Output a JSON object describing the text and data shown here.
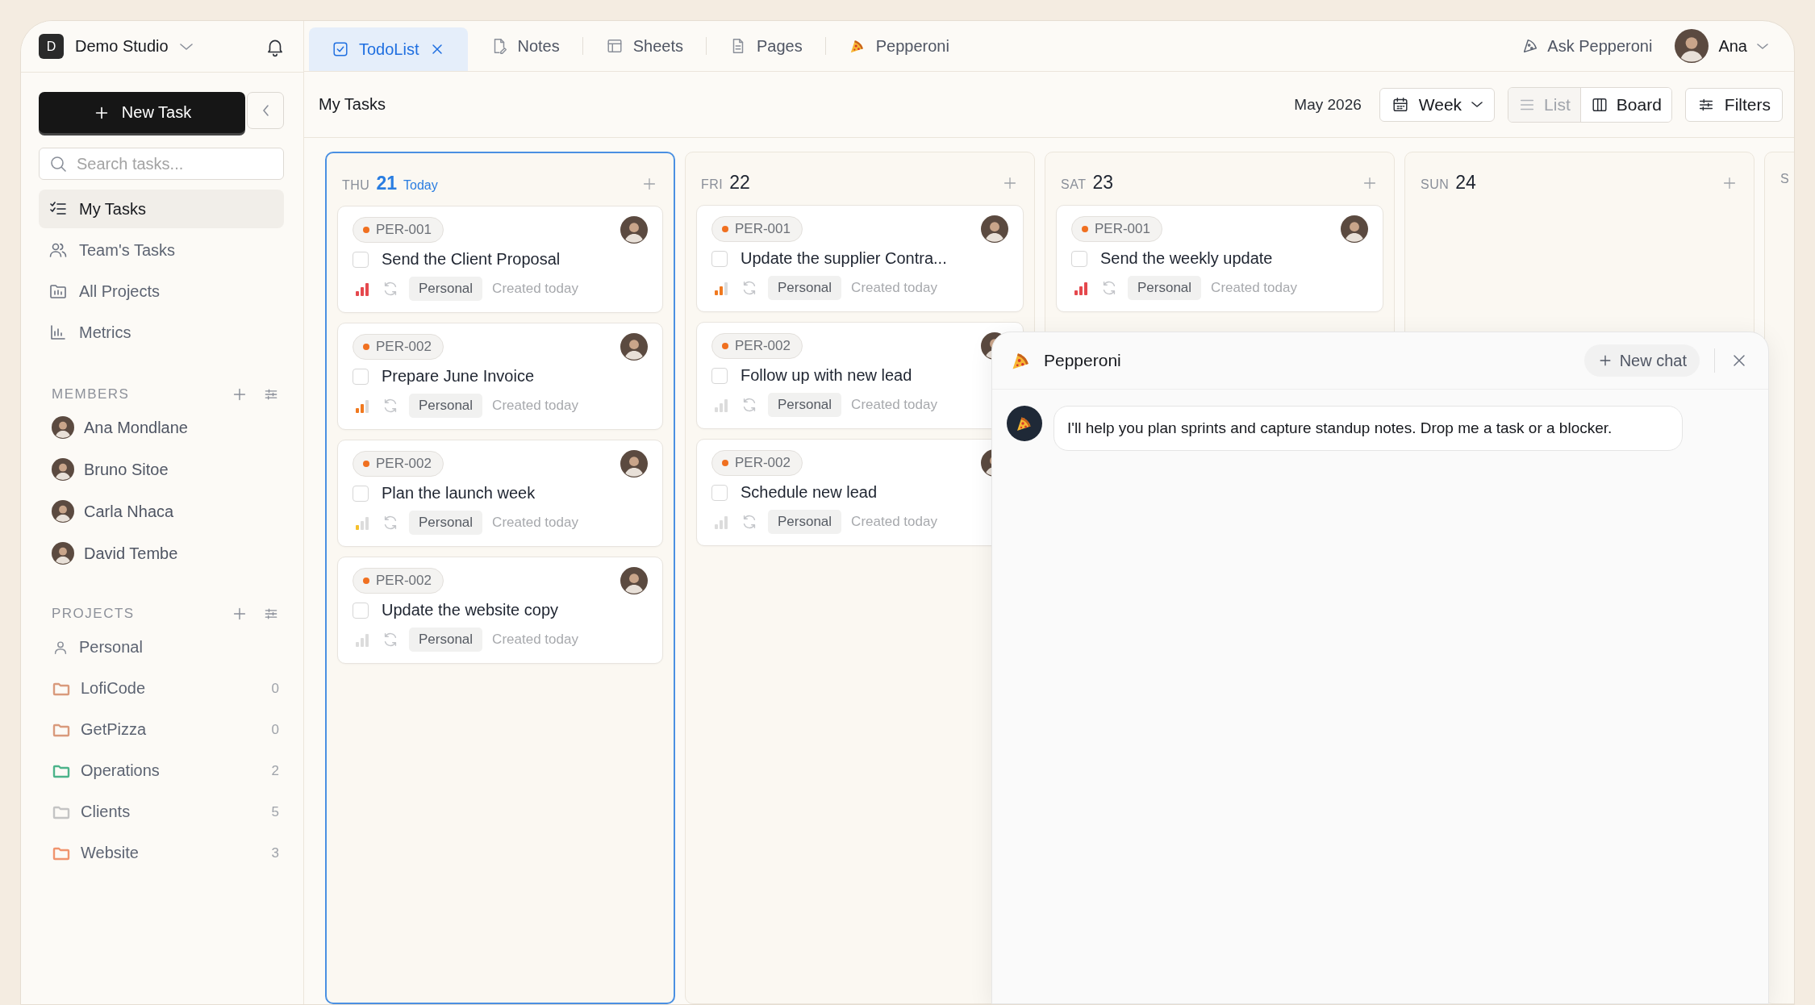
{
  "workspace": {
    "initial": "D",
    "name": "Demo Studio"
  },
  "sidebar": {
    "new_task": "New Task",
    "search": {
      "placeholder": "Search tasks..."
    },
    "nav": [
      {
        "label": "My Tasks",
        "selected": true
      },
      {
        "label": "Team's Tasks",
        "selected": false
      },
      {
        "label": "All Projects",
        "selected": false
      },
      {
        "label": "Metrics",
        "selected": false
      }
    ],
    "members": {
      "title": "MEMBERS",
      "items": [
        {
          "name": "Ana Mondlane"
        },
        {
          "name": "Bruno Sitoe"
        },
        {
          "name": "Carla Nhaca"
        },
        {
          "name": "David Tembe"
        }
      ]
    },
    "projects": {
      "title": "PROJECTS",
      "items": [
        {
          "kind": "person",
          "name": "Personal"
        },
        {
          "kind": "folder",
          "name": "LofiCode",
          "color": "#d99a7c",
          "count": "0"
        },
        {
          "kind": "folder",
          "name": "GetPizza",
          "color": "#d99a7c",
          "count": "0"
        },
        {
          "kind": "folder",
          "name": "Operations",
          "color": "#4cb38a",
          "count": "2"
        },
        {
          "kind": "folder",
          "name": "Clients",
          "color": "#c4c4c4",
          "count": "5"
        },
        {
          "kind": "folder",
          "name": "Website",
          "color": "#f0946e",
          "count": "3"
        }
      ]
    }
  },
  "tabs": [
    {
      "label": "TodoList",
      "selected": true
    },
    {
      "label": "Notes",
      "selected": false
    },
    {
      "label": "Sheets",
      "selected": false
    },
    {
      "label": "Pages",
      "selected": false
    },
    {
      "label": "Pepperoni",
      "selected": false
    }
  ],
  "header": {
    "ask": "Ask Pepperoni",
    "user": "Ana"
  },
  "toolbar": {
    "title": "My Tasks",
    "month": "May 2026",
    "range": "Week",
    "views": [
      {
        "label": "List",
        "selected": false
      },
      {
        "label": "Board",
        "selected": true
      }
    ],
    "filters": "Filters"
  },
  "columns": [
    {
      "weekday": "THU",
      "day": "21",
      "today": true,
      "today_label": "Today",
      "cards": [
        {
          "id": "PER-001",
          "title": "Send the Client Proposal",
          "checked": false,
          "level": 1,
          "tag": "Personal",
          "created": "Created today"
        },
        {
          "id": "PER-002",
          "title": "Prepare June Invoice",
          "checked": false,
          "level": 0.67,
          "tag": "Personal",
          "created": "Created today"
        },
        {
          "id": "PER-002",
          "title": "Plan the launch week",
          "checked": false,
          "level": 0.33,
          "tag": "Personal",
          "created": "Created today"
        },
        {
          "id": "PER-002",
          "title": "Update the website copy",
          "checked": false,
          "level": 0,
          "tag": "Personal",
          "created": "Created today"
        }
      ]
    },
    {
      "weekday": "FRI",
      "day": "22",
      "today": false,
      "cards": [
        {
          "id": "PER-001",
          "title": "Update the supplier Contra...",
          "checked": false,
          "level": 0.67,
          "tag": "Personal",
          "created": "Created today"
        },
        {
          "id": "PER-002",
          "title": "Follow up with new lead",
          "checked": false,
          "level": 0,
          "tag": "Personal",
          "created": "Created today"
        },
        {
          "id": "PER-002",
          "title": "Schedule new lead",
          "checked": false,
          "level": 0,
          "tag": "Personal",
          "created": "Created today"
        }
      ]
    },
    {
      "weekday": "SAT",
      "day": "23",
      "today": false,
      "cards": [
        {
          "id": "PER-001",
          "title": "Send the weekly update",
          "checked": false,
          "level": 1,
          "tag": "Personal",
          "created": "Created today"
        }
      ]
    },
    {
      "weekday": "SUN",
      "day": "24",
      "today": false
    },
    {
      "weekday": "S",
      "today": false
    }
  ],
  "chat": {
    "title": "Pepperoni",
    "new_chat": "New chat",
    "messages": [
      {
        "text": "I'll help you plan sprints and capture standup notes. Drop me a task or a blocker."
      }
    ]
  }
}
